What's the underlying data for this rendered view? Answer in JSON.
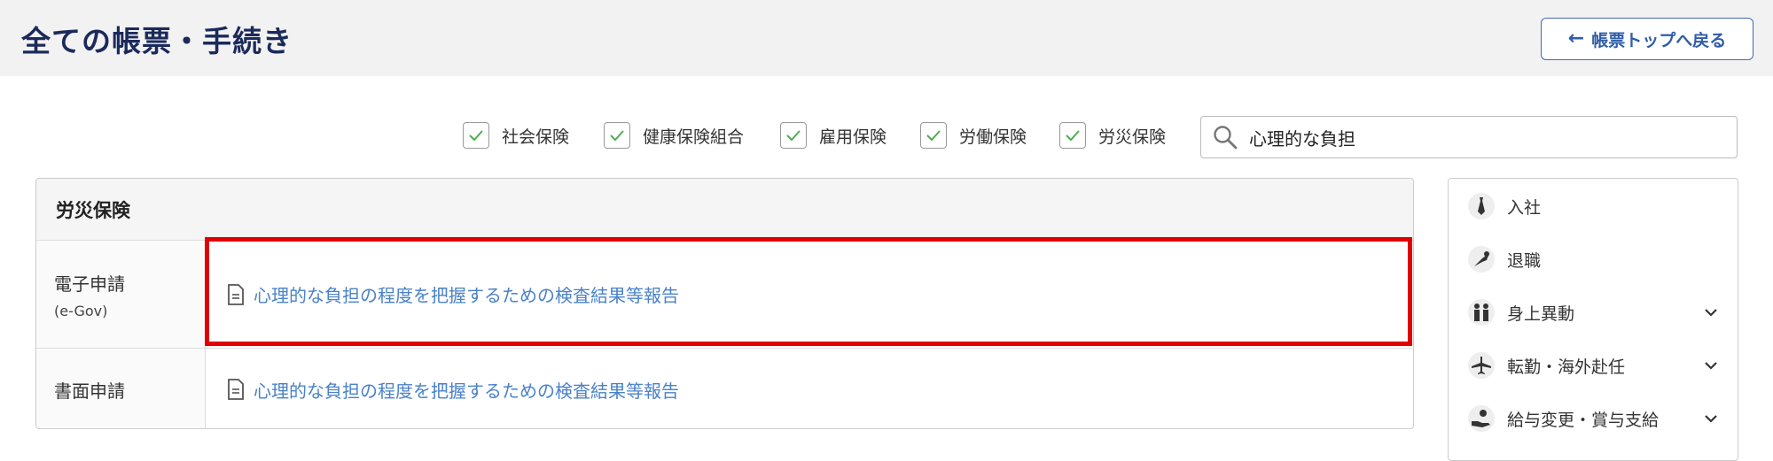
{
  "header": {
    "title": "全ての帳票・手続き",
    "back_label": "帳票トップへ戻る",
    "back_arrow": "←"
  },
  "filters": [
    {
      "label": "社会保険",
      "checked": true
    },
    {
      "label": "健康保険組合",
      "checked": true
    },
    {
      "label": "雇用保険",
      "checked": true
    },
    {
      "label": "労働保険",
      "checked": true
    },
    {
      "label": "労災保険",
      "checked": true
    }
  ],
  "search": {
    "value": "心理的な負担",
    "icon": "search-icon"
  },
  "section": {
    "title": "労災保険",
    "rows": [
      {
        "label": "電子申請",
        "sublabel": "(e-Gov)",
        "link": "心理的な負担の程度を把握するための検査結果等報告"
      },
      {
        "label": "書面申請",
        "link": "心理的な負担の程度を把握するための検査結果等報告"
      }
    ]
  },
  "sidebar": {
    "items": [
      {
        "label": "入社",
        "icon": "tie-icon",
        "expandable": false
      },
      {
        "label": "退職",
        "icon": "bouquet-icon",
        "expandable": false
      },
      {
        "label": "身上異動",
        "icon": "family-icon",
        "expandable": true
      },
      {
        "label": "転勤・海外赴任",
        "icon": "airplane-icon",
        "expandable": true
      },
      {
        "label": "給与変更・賞与支給",
        "icon": "money-hand-icon",
        "expandable": true
      }
    ]
  },
  "colors": {
    "title": "#1b2a5b",
    "accent": "#2f5da8",
    "link": "#4a82c8",
    "check": "#4caf50",
    "highlight": "#e00000"
  }
}
